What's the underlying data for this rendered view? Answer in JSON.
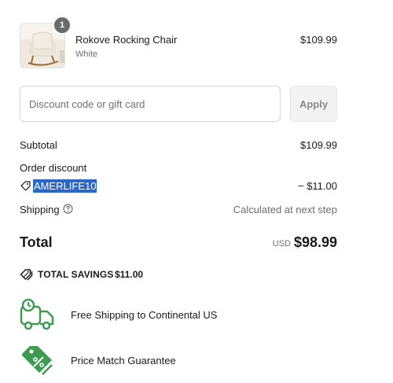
{
  "product": {
    "name": "Rokove Rocking Chair",
    "variant": "White",
    "price": "$109.99",
    "quantity": "1"
  },
  "discount": {
    "placeholder": "Discount code or gift card",
    "apply_label": "Apply"
  },
  "summary": {
    "subtotal_label": "Subtotal",
    "subtotal_value": "$109.99",
    "order_discount_label": "Order discount",
    "discount_code": "AMERLIFE10",
    "discount_value": "− $11.00",
    "shipping_label": "Shipping",
    "shipping_value": "Calculated at next step",
    "total_label": "Total",
    "total_currency": "USD",
    "total_value": "$98.99"
  },
  "savings": {
    "label": "TOTAL SAVINGS",
    "amount": "$11.00"
  },
  "perks": [
    {
      "text": "Free Shipping to Continental US",
      "icon": "truck-icon"
    },
    {
      "text": "Price Match Guarantee",
      "icon": "price-tag-icon"
    }
  ],
  "colors": {
    "accent_green": "#3f9a52",
    "selection_blue": "#2b67c9",
    "badge_gray": "#6b6b6b"
  }
}
